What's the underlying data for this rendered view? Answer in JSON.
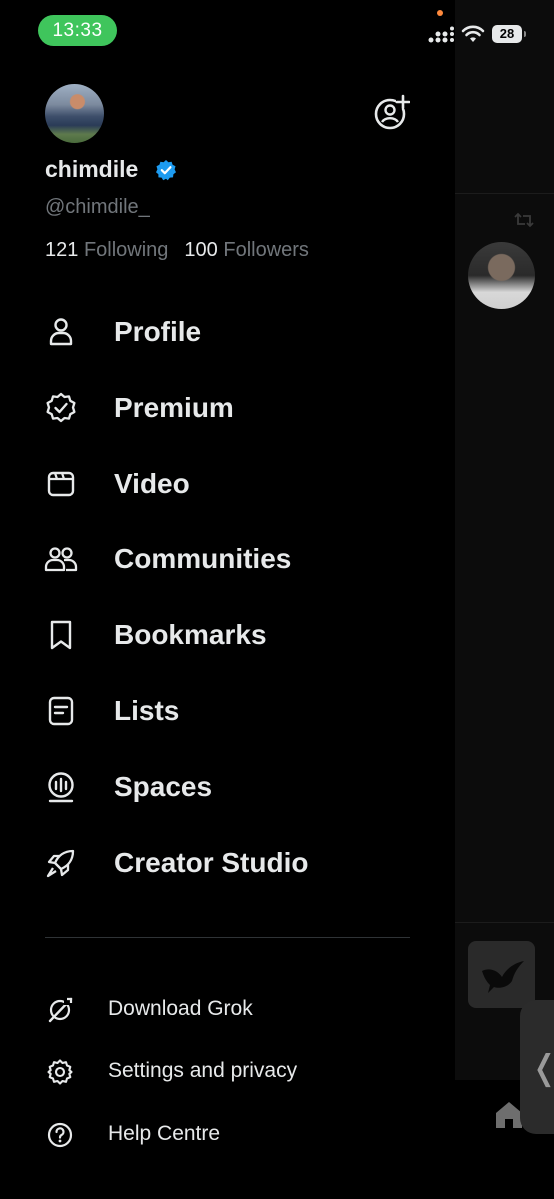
{
  "status_bar": {
    "time": "13:33",
    "battery": "28"
  },
  "profile": {
    "display_name": "chimdile",
    "handle": "@chimdile_",
    "following_count": "121",
    "following_label": "Following",
    "followers_count": "100",
    "followers_label": "Followers",
    "verified_color": "#1d9bf0"
  },
  "nav": {
    "items": [
      {
        "label": "Profile",
        "icon": "person-icon"
      },
      {
        "label": "Premium",
        "icon": "verified-badge-icon"
      },
      {
        "label": "Video",
        "icon": "video-clapper-icon"
      },
      {
        "label": "Communities",
        "icon": "people-icon"
      },
      {
        "label": "Bookmarks",
        "icon": "bookmark-icon"
      },
      {
        "label": "Lists",
        "icon": "list-icon"
      },
      {
        "label": "Spaces",
        "icon": "spaces-mic-icon"
      },
      {
        "label": "Creator Studio",
        "icon": "rocket-icon"
      }
    ]
  },
  "secondary": {
    "items": [
      {
        "label": "Download Grok",
        "icon": "grok-icon"
      },
      {
        "label": "Settings and privacy",
        "icon": "gear-icon"
      },
      {
        "label": "Help Centre",
        "icon": "help-icon"
      }
    ]
  },
  "colors": {
    "background": "#000000",
    "text_primary": "#e7e9ea",
    "text_secondary": "#71767b",
    "time_pill": "#3fc55c"
  }
}
